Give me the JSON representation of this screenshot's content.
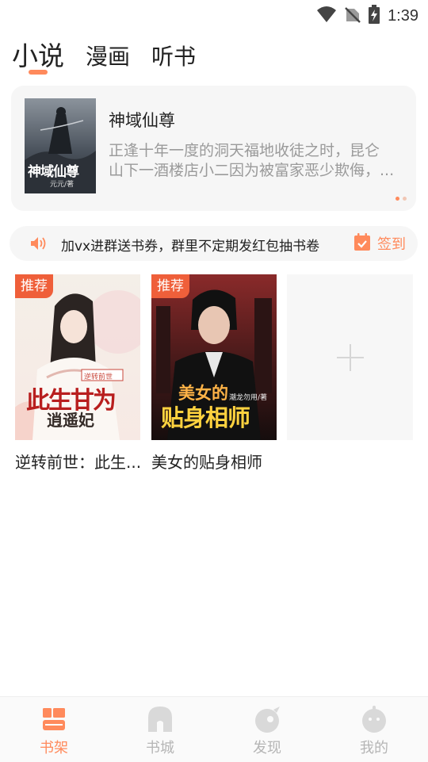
{
  "status_bar": {
    "time": "1:39"
  },
  "tabs": [
    {
      "label": "小说",
      "active": true
    },
    {
      "label": "漫画",
      "active": false
    },
    {
      "label": "听书",
      "active": false
    }
  ],
  "featured": {
    "title": "神域仙尊",
    "description_line1": "正逢十年一度的洞天福地收徒之时，昆仑",
    "description_line2": "山下一酒楼店小二因为被富家恶少欺侮，...",
    "cover_text": "神域仙尊",
    "cover_author": "元元/著",
    "pages": 2,
    "current_page": 1
  },
  "notice": {
    "text": "加vx进群送书券，群里不定期发红包抽书卷",
    "checkin_label": "签到"
  },
  "shelf": {
    "books": [
      {
        "title": "逆转前世：此生...",
        "badge": "推荐",
        "cover_tag": "逆转前世",
        "cover_text": "此生甘为",
        "cover_text2": "逍遥妃"
      },
      {
        "title": "美女的贴身相师",
        "badge": "推荐",
        "cover_text": "美女的",
        "cover_text2": "贴身相师",
        "cover_author": "潮龙勿用/著"
      }
    ]
  },
  "bottom_nav": [
    {
      "label": "书架",
      "active": true,
      "icon": "bookshelf-icon"
    },
    {
      "label": "书城",
      "active": false,
      "icon": "bookstore-icon"
    },
    {
      "label": "发现",
      "active": false,
      "icon": "discover-icon"
    },
    {
      "label": "我的",
      "active": false,
      "icon": "profile-icon"
    }
  ],
  "colors": {
    "accent": "#ff8a5c",
    "badge": "#ef5f3a",
    "inactive": "#b5b5b5",
    "card_bg": "#f6f6f6"
  }
}
